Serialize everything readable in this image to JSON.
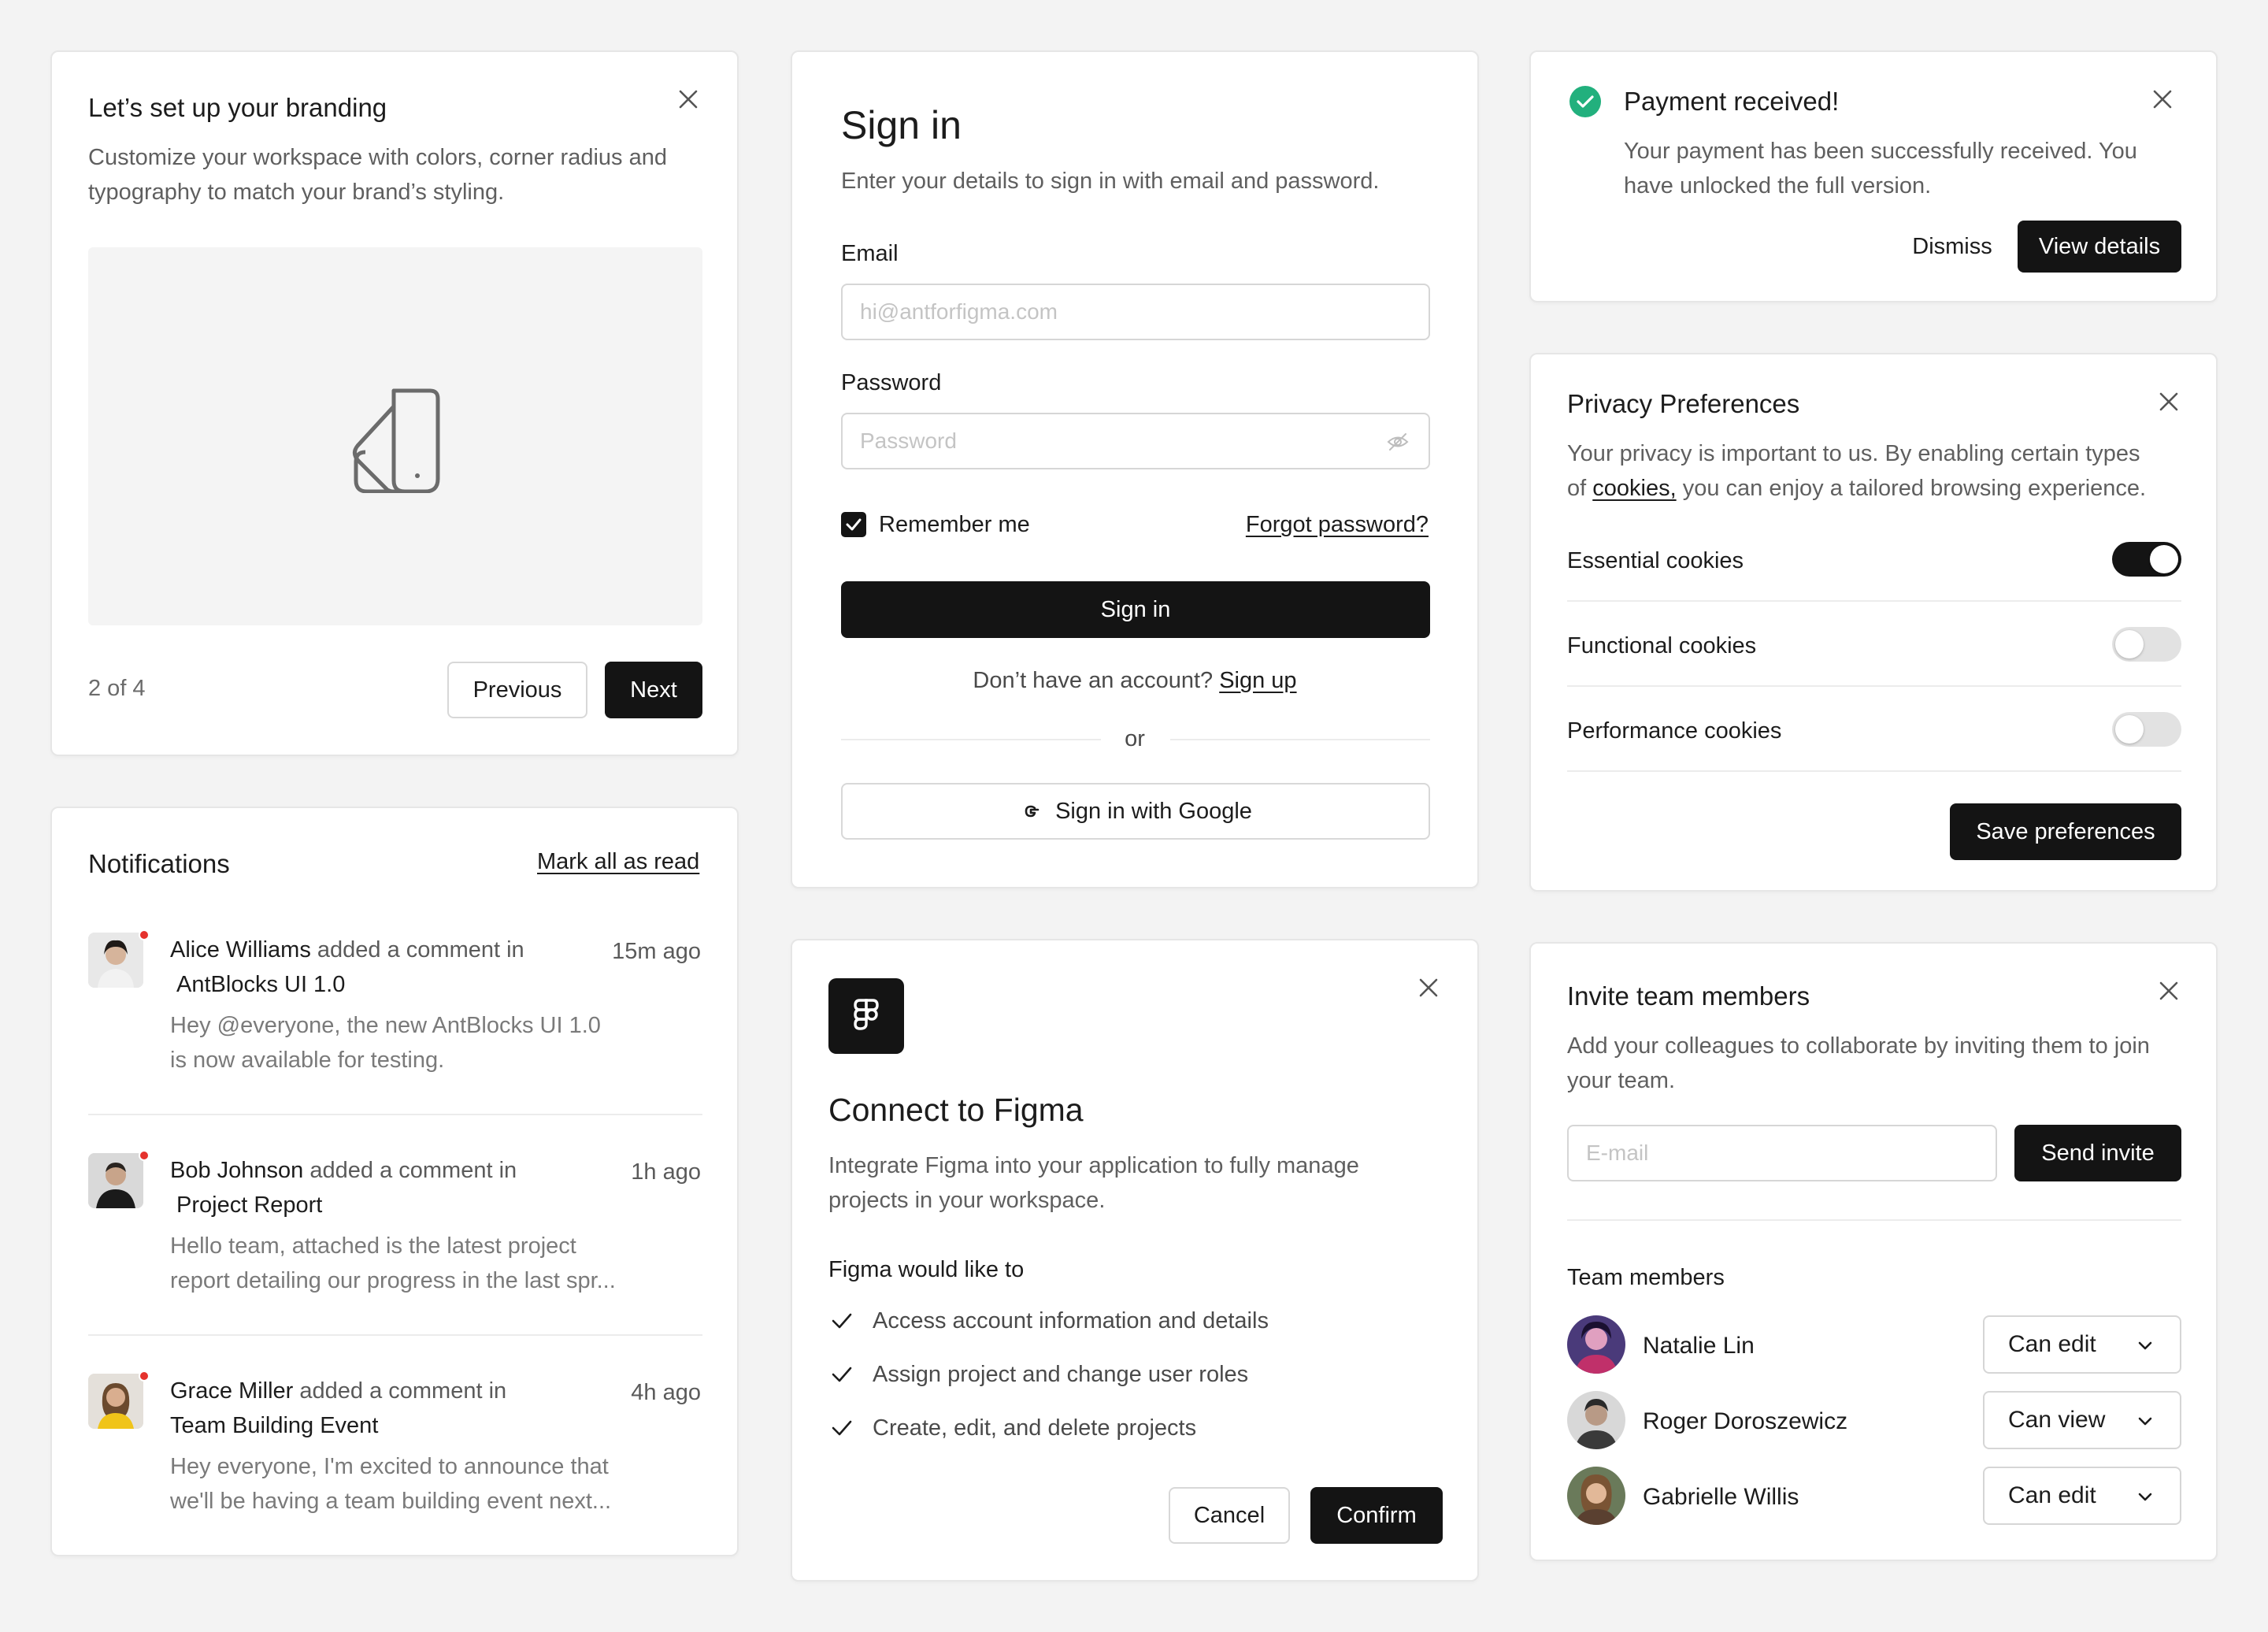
{
  "branding": {
    "title": "Let’s set up your branding",
    "desc_line1": "Customize your workspace with colors, corner radius and",
    "desc_line2": "typography to match your brand’s styling.",
    "pager": "2 of 4",
    "prev_label": "Previous",
    "next_label": "Next"
  },
  "signin": {
    "title": "Sign in",
    "subtitle": "Enter your details to sign in with email and password.",
    "email_label": "Email",
    "email_placeholder": "hi@antforfigma.com",
    "password_label": "Password",
    "password_placeholder": "Password",
    "remember_label": "Remember me",
    "remember_checked": true,
    "forgot_label": "Forgot password?",
    "submit_label": "Sign in",
    "no_account": "Don’t have an account?",
    "signup_label": "Sign up",
    "or_label": "or",
    "google_label": "Sign in with Google"
  },
  "payment": {
    "title": "Payment received!",
    "desc_line1": "Your payment has been successfully received. You",
    "desc_line2": "have unlocked the full version.",
    "dismiss_label": "Dismiss",
    "view_label": "View details",
    "success_color": "#22b07d"
  },
  "privacy": {
    "title": "Privacy Preferences",
    "desc_line1": "Your privacy is important to us. By enabling certain types",
    "desc_pre": "of",
    "desc_link": "cookies,",
    "desc_post": "you can enjoy a tailored browsing experience.",
    "items": [
      {
        "label": "Essential cookies",
        "enabled": true
      },
      {
        "label": "Functional cookies",
        "enabled": false
      },
      {
        "label": "Performance cookies",
        "enabled": false
      }
    ],
    "save_label": "Save preferences"
  },
  "notifications": {
    "title": "Notifications",
    "mark_all_label": "Mark all as read",
    "items": [
      {
        "name": "Alice Williams",
        "action": "added a comment in",
        "target": "AntBlocks UI 1.0",
        "time": "15m ago",
        "body1": "Hey @everyone, the new AntBlocks UI 1.0",
        "body2": "is now available for testing."
      },
      {
        "name": "Bob Johnson",
        "action": "added a comment in",
        "target": "Project Report",
        "time": "1h ago",
        "body1": "Hello team, attached is the latest project",
        "body2": "report detailing our progress in the last spr..."
      },
      {
        "name": "Grace Miller",
        "action": "added a comment in",
        "target": "Team Building Event",
        "time": "4h ago",
        "body1": "Hey everyone, I'm excited to announce that",
        "body2": "we'll be having a team building event next..."
      }
    ]
  },
  "figma": {
    "title": "Connect to Figma",
    "desc_line1": "Integrate Figma into your application to fully manage",
    "desc_line2": "projects in your workspace.",
    "perm_heading": "Figma would like to",
    "perms": [
      "Access account information and details",
      "Assign project and change user roles",
      "Create, edit, and delete projects"
    ],
    "cancel_label": "Cancel",
    "confirm_label": "Confirm"
  },
  "invite": {
    "title": "Invite team members",
    "desc_line1": "Add your colleagues to collaborate by inviting them to join",
    "desc_line2": "your team.",
    "email_placeholder": "E-mail",
    "send_label": "Send invite",
    "members_heading": "Team members",
    "members": [
      {
        "name": "Natalie Lin",
        "permission": "Can edit"
      },
      {
        "name": "Roger Doroszewicz",
        "permission": "Can view"
      },
      {
        "name": "Gabrielle Willis",
        "permission": "Can edit"
      }
    ]
  }
}
